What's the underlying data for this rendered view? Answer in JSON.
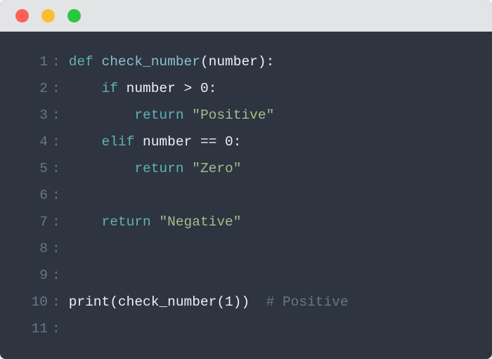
{
  "window": {
    "dots": [
      "red",
      "yellow",
      "green"
    ]
  },
  "colors": {
    "keyword": "#5fb3b3",
    "function": "#88c0d0",
    "string": "#a3be8c",
    "comment": "#6c7685",
    "text": "#eceff4",
    "background": "#2e3440",
    "titlebar": "#e3e4e6"
  },
  "code": {
    "lines": [
      {
        "n": 1,
        "tokens": [
          {
            "t": "def ",
            "c": "kw"
          },
          {
            "t": "check_number",
            "c": "fn"
          },
          {
            "t": "(number):",
            "c": "nm"
          }
        ]
      },
      {
        "n": 2,
        "tokens": [
          {
            "t": "    ",
            "c": "nm"
          },
          {
            "t": "if ",
            "c": "kw"
          },
          {
            "t": "number > 0:",
            "c": "nm"
          }
        ]
      },
      {
        "n": 3,
        "tokens": [
          {
            "t": "        ",
            "c": "nm"
          },
          {
            "t": "return ",
            "c": "kw"
          },
          {
            "t": "\"Positive\"",
            "c": "str"
          }
        ]
      },
      {
        "n": 4,
        "tokens": [
          {
            "t": "    ",
            "c": "nm"
          },
          {
            "t": "elif ",
            "c": "kw"
          },
          {
            "t": "number == 0:",
            "c": "nm"
          }
        ]
      },
      {
        "n": 5,
        "tokens": [
          {
            "t": "        ",
            "c": "nm"
          },
          {
            "t": "return ",
            "c": "kw"
          },
          {
            "t": "\"Zero\"",
            "c": "str"
          }
        ]
      },
      {
        "n": 6,
        "tokens": []
      },
      {
        "n": 7,
        "tokens": [
          {
            "t": "    ",
            "c": "nm"
          },
          {
            "t": "return ",
            "c": "kw"
          },
          {
            "t": "\"Negative\"",
            "c": "str"
          }
        ]
      },
      {
        "n": 8,
        "tokens": []
      },
      {
        "n": 9,
        "tokens": []
      },
      {
        "n": 10,
        "tokens": [
          {
            "t": "print(check_number(1))  ",
            "c": "nm"
          },
          {
            "t": "# Positive",
            "c": "cmt"
          }
        ]
      },
      {
        "n": 11,
        "tokens": []
      }
    ]
  }
}
